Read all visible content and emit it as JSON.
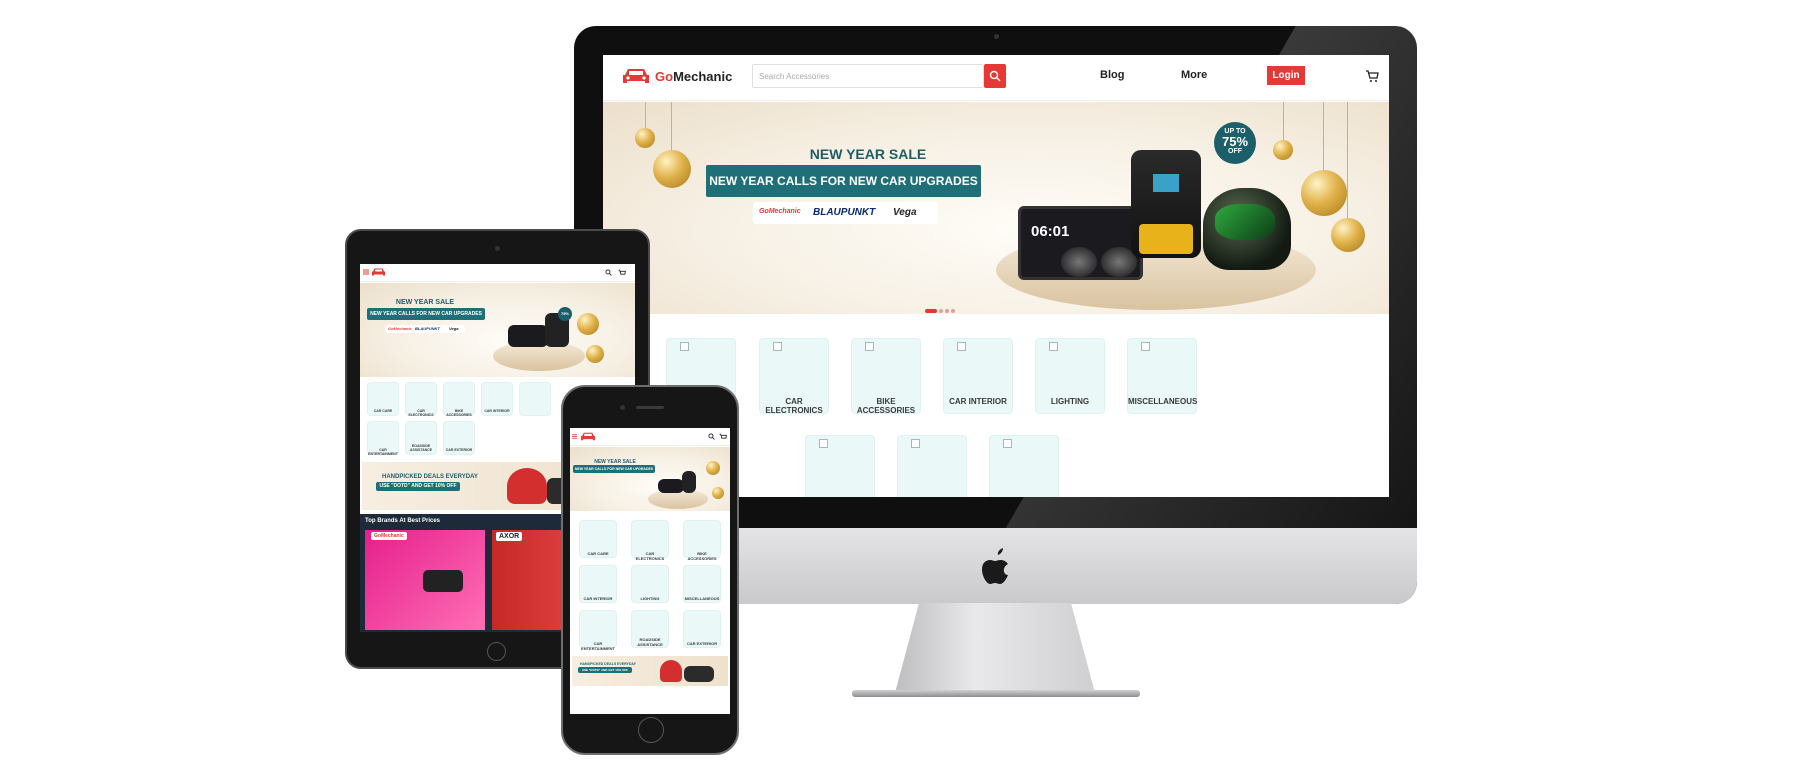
{
  "brand": {
    "name_part1": "Go",
    "name_part2": "Mechanic"
  },
  "desktop": {
    "search_placeholder": "Search Accessories",
    "nav": {
      "blog": "Blog",
      "more": "More",
      "login": "Login"
    },
    "banner": {
      "title": "NEW YEAR SALE",
      "subtitle": "NEW YEAR CALLS FOR NEW CAR UPGRADES",
      "brands": [
        "GoMechanic",
        "BLAUPUNKT",
        "Vega"
      ],
      "badge_top": "UP TO",
      "badge_value": "75%",
      "badge_bottom": "OFF",
      "screen_time": "06:01"
    },
    "categories_row1": [
      "CAR ELECTRONICS",
      "BIKE ACCESSORIES",
      "CAR INTERIOR",
      "LIGHTING",
      "MISCELLANEOUS"
    ]
  },
  "tablet": {
    "banner": {
      "title": "NEW YEAR SALE",
      "subtitle": "NEW YEAR CALLS FOR NEW CAR UPGRADES",
      "brands": [
        "GoMechanic",
        "BLAUPUNKT",
        "Vega"
      ]
    },
    "categories": [
      "CAR CARE",
      "CAR ELECTRONICS",
      "BIKE ACCESSORIES",
      "CAR INTERIOR",
      "",
      "CAR ENTERTAINMENT",
      "ROADSIDE ASSISTANCE",
      "CAR EXTERIOR"
    ],
    "promo": {
      "line1": "HANDPICKED DEALS EVERYDAY",
      "line2": "USE \"DOTD\" AND GET 10% OFF"
    },
    "brands_title": "Top Brands At Best Prices",
    "brand_cards": [
      "GoMechanic",
      "AXOR"
    ]
  },
  "phone": {
    "banner": {
      "title": "NEW YEAR SALE",
      "subtitle": "NEW YEAR CALLS FOR NEW CAR UPGRADES"
    },
    "categories": [
      "CAR CARE",
      "CAR ELECTRONICS",
      "BIKE ACCESSORIES",
      "CAR INTERIOR",
      "LIGHTING",
      "MISCELLANEOUS",
      "CAR ENTERTAINMENT",
      "ROADSIDE ASSISTANCE",
      "CAR EXTERIOR"
    ],
    "promo": {
      "line1": "HANDPICKED DEALS EVERYDAY",
      "line2": "USE \"DOTD\" AND GET 10% OFF"
    }
  },
  "colors": {
    "brand_red": "#e53935",
    "teal": "#1f6f78",
    "tile_bg": "#eaf8f8"
  },
  "icons": [
    "car-logo-icon",
    "search-icon",
    "cart-icon",
    "hamburger-icon",
    "apple-logo-icon"
  ]
}
